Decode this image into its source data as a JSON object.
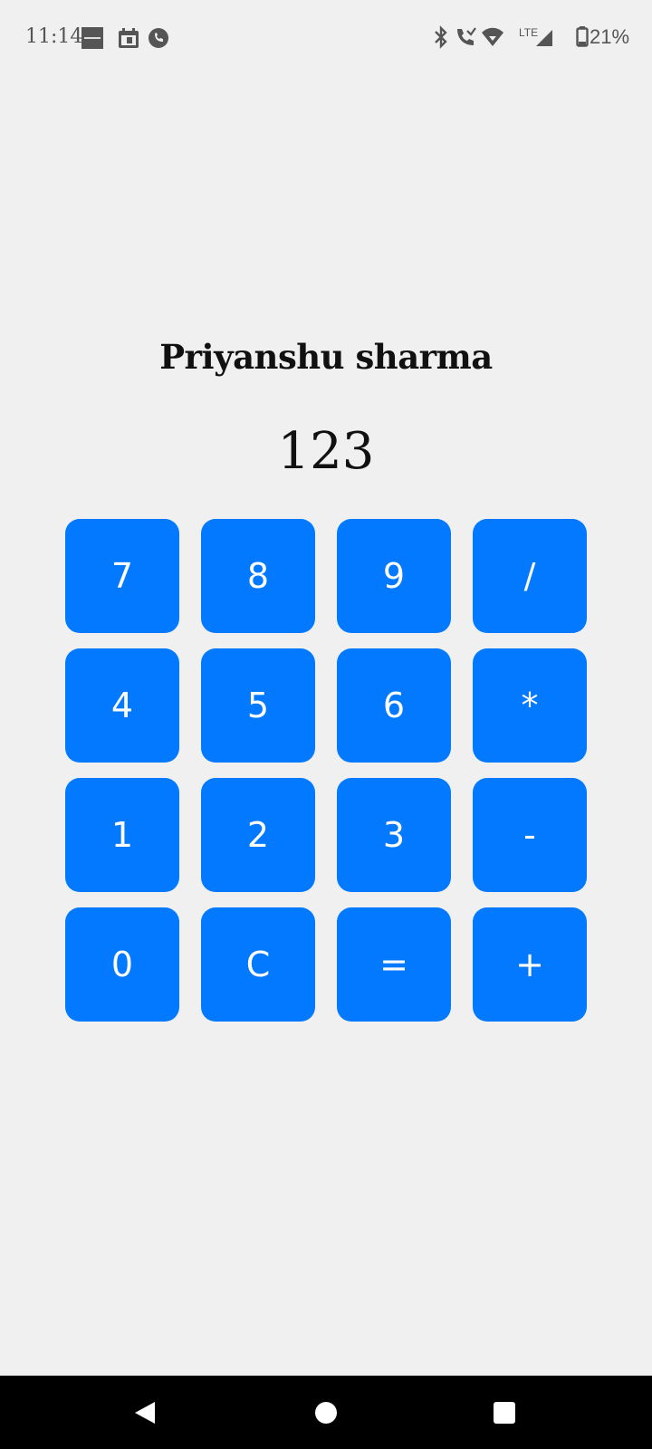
{
  "status_bar": {
    "time": "11:14",
    "notification_icons": [
      "zomato-app-icon",
      "calendar-app-icon",
      "viber-app-icon"
    ],
    "system_icons": [
      "bluetooth-icon",
      "wifi-calling-icon",
      "wifi-icon",
      "lte-signal-icon",
      "battery-icon"
    ],
    "network_label": "LTE",
    "battery_percent": "21%"
  },
  "app": {
    "title": "Priyanshu sharma",
    "display": "123"
  },
  "keypad": {
    "keys": [
      {
        "label": "7",
        "name": "key-7"
      },
      {
        "label": "8",
        "name": "key-8"
      },
      {
        "label": "9",
        "name": "key-9"
      },
      {
        "label": "/",
        "name": "key-divide"
      },
      {
        "label": "4",
        "name": "key-4"
      },
      {
        "label": "5",
        "name": "key-5"
      },
      {
        "label": "6",
        "name": "key-6"
      },
      {
        "label": "*",
        "name": "key-multiply"
      },
      {
        "label": "1",
        "name": "key-1"
      },
      {
        "label": "2",
        "name": "key-2"
      },
      {
        "label": "3",
        "name": "key-3"
      },
      {
        "label": "-",
        "name": "key-subtract"
      },
      {
        "label": "0",
        "name": "key-0"
      },
      {
        "label": "C",
        "name": "key-clear"
      },
      {
        "label": "=",
        "name": "key-equals"
      },
      {
        "label": "+",
        "name": "key-add"
      }
    ],
    "button_color": "#0279ff",
    "label_color": "#ffffff"
  },
  "nav_bar": {
    "buttons": [
      "back-icon",
      "home-icon",
      "recents-icon"
    ]
  }
}
